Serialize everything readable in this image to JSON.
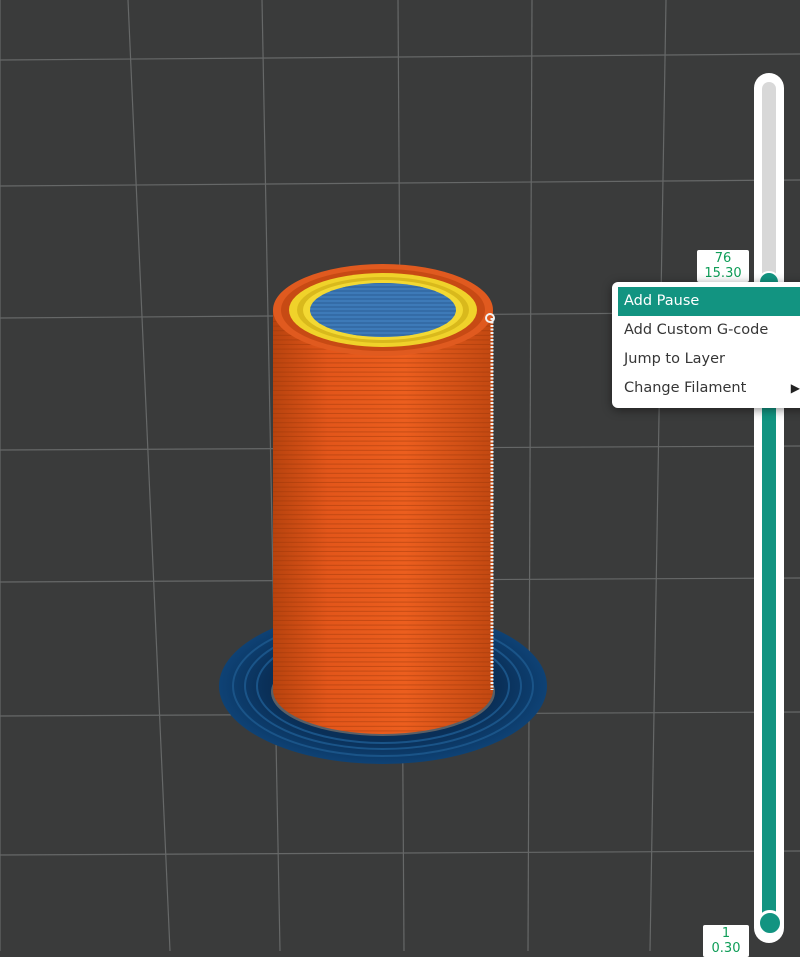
{
  "viewport": {
    "background_color": "#3a3b3b",
    "grid_color": "#666868",
    "model": {
      "outer_wall_color": "#e8591c",
      "inner_wall_color": "#f2d32a",
      "top_infill_color": "#3d7ab8",
      "brim_color": "#0d3c6b",
      "seam_color": "#ffffff"
    }
  },
  "layer_slider": {
    "top_layer": "76",
    "top_height": "15.30",
    "bottom_layer": "1",
    "bottom_height": "0.30",
    "active_color": "#129481"
  },
  "context_menu": {
    "items": [
      {
        "label": "Add Pause",
        "active": true
      },
      {
        "label": "Add Custom G-code",
        "active": false
      },
      {
        "label": "Jump to Layer",
        "active": false
      },
      {
        "label": "Change Filament",
        "active": false,
        "submenu_arrow": "▶"
      }
    ]
  }
}
